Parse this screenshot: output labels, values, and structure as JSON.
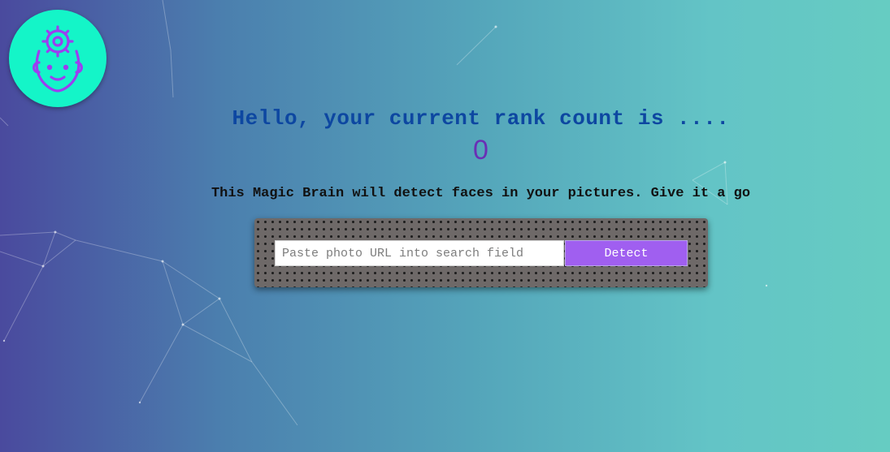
{
  "logo": {
    "icon": "brain-gear-head-icon",
    "background_color": "#14f5c8",
    "stroke_color": "#9b3ff0"
  },
  "rank": {
    "message": "Hello, your current rank count is ....",
    "count": "0"
  },
  "description": "This Magic Brain will detect faces in your pictures. Give it a go",
  "form": {
    "input_value": "",
    "input_placeholder": "Paste photo URL into search field",
    "button_label": "Detect"
  },
  "colors": {
    "heading": "#0d47a1",
    "count": "#6a2fb5",
    "button": "#a05ff0"
  }
}
